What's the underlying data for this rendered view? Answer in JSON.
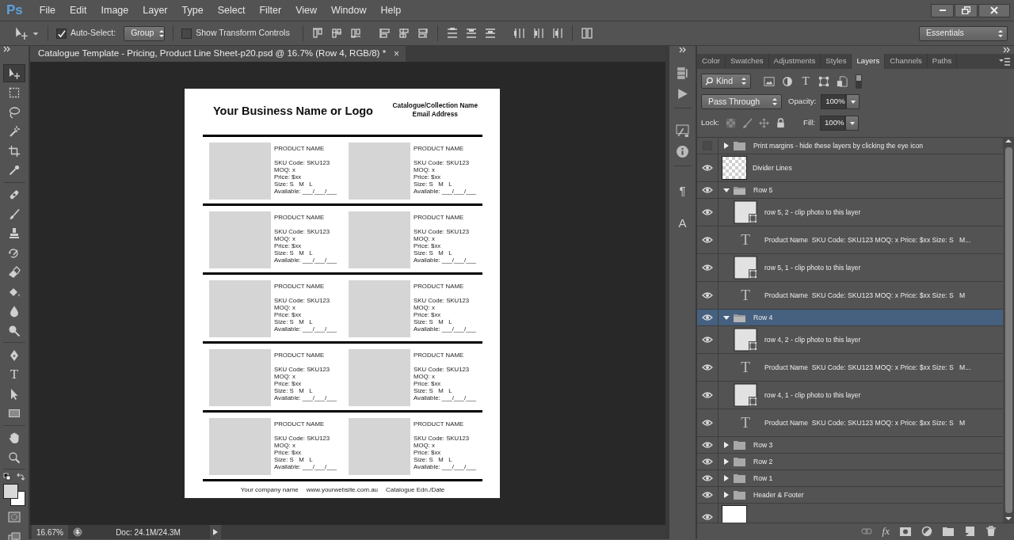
{
  "app": {
    "logo": "Ps"
  },
  "menu": [
    "File",
    "Edit",
    "Image",
    "Layer",
    "Type",
    "Select",
    "Filter",
    "View",
    "Window",
    "Help"
  ],
  "options_bar": {
    "auto_select": {
      "label": "Auto-Select:",
      "checked": true
    },
    "target": "Group",
    "transform_controls": {
      "label": "Show Transform Controls",
      "checked": false
    },
    "workspace": "Essentials"
  },
  "document_tab": {
    "title": "Catalogue Template - Pricing, Product Line Sheet-p20.psd @ 16.7% (Row 4, RGB/8) *",
    "close": "×"
  },
  "tool_groups": [
    {
      "tools": [
        {
          "kind": "move",
          "selected": true
        },
        {
          "kind": "marquee",
          "selected": false
        },
        {
          "kind": "lasso",
          "selected": false
        },
        {
          "kind": "wand",
          "selected": false
        },
        {
          "kind": "crop",
          "selected": false
        },
        {
          "kind": "eyedropper",
          "selected": false
        }
      ]
    },
    {
      "tools": [
        {
          "kind": "heal",
          "selected": false
        },
        {
          "kind": "brush",
          "selected": false
        },
        {
          "kind": "stamp",
          "selected": false
        },
        {
          "kind": "history_brush",
          "selected": false
        },
        {
          "kind": "eraser",
          "selected": false
        },
        {
          "kind": "bucket",
          "selected": false
        },
        {
          "kind": "blur",
          "selected": false
        },
        {
          "kind": "dodge",
          "selected": false
        }
      ]
    },
    {
      "tools": [
        {
          "kind": "pen",
          "selected": false
        },
        {
          "kind": "type",
          "glyph": "T",
          "selected": false
        },
        {
          "kind": "path_select",
          "selected": false
        },
        {
          "kind": "rectangle",
          "selected": false
        }
      ]
    },
    {
      "tools": [
        {
          "kind": "hand",
          "selected": false
        },
        {
          "kind": "zoom",
          "selected": false
        }
      ]
    }
  ],
  "document": {
    "title": "Your Business Name or Logo",
    "catalogue": "Catalogue/Collection Name",
    "email": "Email Address",
    "rows": [
      {
        "products": [
          {
            "name": "PRODUCT NAME",
            "sku": "SKU Code: SKU123",
            "moq": "MOQ: x",
            "price": "Price: $xx",
            "size": "Size: S   M   L",
            "available": "Available: ___/___/___"
          },
          {
            "name": "PRODUCT NAME",
            "sku": "SKU Code: SKU123",
            "moq": "MOQ: x",
            "price": "Price: $xx",
            "size": "Size: S   M   L",
            "available": "Available: ___/___/___"
          }
        ]
      },
      {
        "products": [
          {
            "name": "PRODUCT NAME",
            "sku": "SKU Code: SKU123",
            "moq": "MOQ: x",
            "price": "Price: $xx",
            "size": "Size: S   M   L",
            "available": "Available: ___/___/___"
          },
          {
            "name": "PRODUCT NAME",
            "sku": "SKU Code: SKU123",
            "moq": "MOQ: x",
            "price": "Price: $xx",
            "size": "Size: S   M   L",
            "available": "Available: ___/___/___"
          }
        ]
      },
      {
        "products": [
          {
            "name": "PRODUCT NAME",
            "sku": "SKU Code: SKU123",
            "moq": "MOQ: x",
            "price": "Price: $xx",
            "size": "Size: S   M   L",
            "available": "Available: ___/___/___"
          },
          {
            "name": "PRODUCT NAME",
            "sku": "SKU Code: SKU123",
            "moq": "MOQ: x",
            "price": "Price: $xx",
            "size": "Size: S   M   L",
            "available": "Available: ___/___/___"
          }
        ]
      },
      {
        "products": [
          {
            "name": "PRODUCT NAME",
            "sku": "SKU Code: SKU123",
            "moq": "MOQ: x",
            "price": "Price: $xx",
            "size": "Size: S   M   L",
            "available": "Available: ___/___/___"
          },
          {
            "name": "PRODUCT NAME",
            "sku": "SKU Code: SKU123",
            "moq": "MOQ: x",
            "price": "Price: $xx",
            "size": "Size: S   M   L",
            "available": "Available: ___/___/___"
          }
        ]
      },
      {
        "products": [
          {
            "name": "PRODUCT NAME",
            "sku": "SKU Code: SKU123",
            "moq": "MOQ: x",
            "price": "Price: $xx",
            "size": "Size: S   M   L",
            "available": "Available: ___/___/___"
          },
          {
            "name": "PRODUCT NAME",
            "sku": "SKU Code: SKU123",
            "moq": "MOQ: x",
            "price": "Price: $xx",
            "size": "Size: S   M   L",
            "available": "Available: ___/___/___"
          }
        ]
      }
    ],
    "footer": [
      "Your company name",
      "www.yourwebsite.com.au",
      "Catalogue Edn./Date"
    ]
  },
  "status_bar": {
    "zoom": "16.67%",
    "doc_size": "Doc: 24.1M/24.3M"
  },
  "side_panel": [
    {
      "kind": "history"
    },
    {
      "kind": "actions"
    },
    {
      "kind": "brush"
    },
    {
      "kind": "info"
    },
    {
      "kind": "paragraph",
      "glyph": "¶"
    },
    {
      "kind": "character",
      "glyph": "A"
    }
  ],
  "panel_tabs": [
    {
      "label": "Color",
      "selected": false
    },
    {
      "label": "Swatches",
      "selected": false
    },
    {
      "label": "Adjustments",
      "selected": false
    },
    {
      "label": "Styles",
      "selected": false
    },
    {
      "label": "Layers",
      "selected": true
    },
    {
      "label": "Channels",
      "selected": false
    },
    {
      "label": "Paths",
      "selected": false
    }
  ],
  "layers_panel": {
    "filter": "Kind",
    "filter_glyph": "T",
    "blend_mode": "Pass Through",
    "opacity_label": "Opacity:",
    "opacity": "100%",
    "lock_label": "Lock:",
    "fill_label": "Fill:",
    "fill": "100%",
    "fx_label": "fx"
  },
  "layers": [
    {
      "kind": "group",
      "name": "Print margins - hide these layers by clicking the eye icon",
      "visible": false,
      "expanded": false,
      "selected": false
    },
    {
      "kind": "pixel",
      "name": "Divider Lines",
      "transparent": true,
      "visible": true,
      "selected": false
    },
    {
      "kind": "group",
      "name": "Row 5",
      "visible": true,
      "expanded": true,
      "selected": false,
      "children": [
        {
          "kind": "shape",
          "name": "row 5, 2 - clip photo to this layer",
          "visible": true,
          "selected": false
        },
        {
          "kind": "text",
          "glyph": "T",
          "name": "Product Name  SKU Code: SKU123 MOQ: x Price: $xx Size: S   M...",
          "visible": true,
          "selected": false
        },
        {
          "kind": "shape",
          "name": "row 5, 1 - clip photo to this layer",
          "visible": true,
          "selected": false
        },
        {
          "kind": "text",
          "glyph": "T",
          "name": "Product Name  SKU Code: SKU123 MOQ: x Price: $xx Size: S   M",
          "visible": true,
          "selected": false
        }
      ]
    },
    {
      "kind": "group",
      "name": "Row 4",
      "visible": true,
      "expanded": true,
      "selected": true,
      "children": [
        {
          "kind": "shape",
          "name": "row 4, 2 - clip photo to this layer",
          "visible": true,
          "selected": false
        },
        {
          "kind": "text",
          "glyph": "T",
          "name": "Product Name  SKU Code: SKU123 MOQ: x Price: $xx Size: S   M...",
          "visible": true,
          "selected": false
        },
        {
          "kind": "shape",
          "name": "row 4, 1 - clip photo to this layer",
          "visible": true,
          "selected": false
        },
        {
          "kind": "text",
          "glyph": "T",
          "name": "Product Name  SKU Code: SKU123 MOQ: x Price: $xx Size: S   M",
          "visible": true,
          "selected": false
        }
      ]
    },
    {
      "kind": "group",
      "name": "Row 3",
      "visible": true,
      "expanded": false,
      "selected": false
    },
    {
      "kind": "group",
      "name": "Row 2",
      "visible": true,
      "expanded": false,
      "selected": false
    },
    {
      "kind": "group",
      "name": "Row 1",
      "visible": true,
      "expanded": false,
      "selected": false
    },
    {
      "kind": "group",
      "name": "Header & Footer",
      "visible": true,
      "expanded": false,
      "selected": false
    },
    {
      "kind": "pixel",
      "transparent": false,
      "visible": true,
      "selected": false
    }
  ]
}
